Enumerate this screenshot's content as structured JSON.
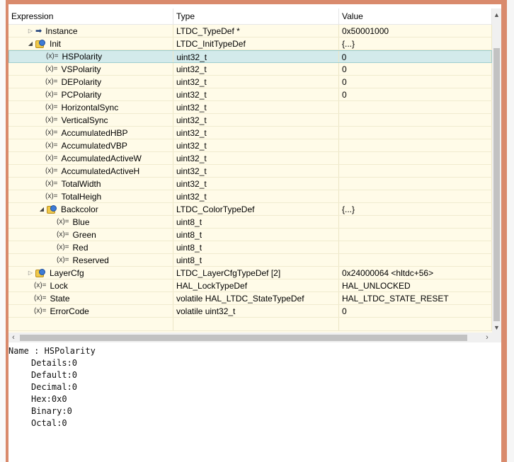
{
  "columns": {
    "expression": "Expression",
    "type": "Type",
    "value": "Value"
  },
  "rows": [
    {
      "depth": 1,
      "arrow": "collapsed",
      "icon": "pointer-icon",
      "name": "Instance",
      "type": "LTDC_TypeDef *",
      "value": "0x50001000"
    },
    {
      "depth": 1,
      "arrow": "expanded",
      "icon": "struct-icon",
      "name": "Init",
      "type": "LTDC_InitTypeDef",
      "value": "{...}"
    },
    {
      "depth": 2,
      "arrow": "none",
      "icon": "variable-icon",
      "name": "HSPolarity",
      "type": "uint32_t",
      "value": "0",
      "selected": true
    },
    {
      "depth": 2,
      "arrow": "none",
      "icon": "variable-icon",
      "name": "VSPolarity",
      "type": "uint32_t",
      "value": "0"
    },
    {
      "depth": 2,
      "arrow": "none",
      "icon": "variable-icon",
      "name": "DEPolarity",
      "type": "uint32_t",
      "value": "0"
    },
    {
      "depth": 2,
      "arrow": "none",
      "icon": "variable-icon",
      "name": "PCPolarity",
      "type": "uint32_t",
      "value": "0"
    },
    {
      "depth": 2,
      "arrow": "none",
      "icon": "variable-icon",
      "name": "HorizontalSync",
      "type": "uint32_t",
      "value": ""
    },
    {
      "depth": 2,
      "arrow": "none",
      "icon": "variable-icon",
      "name": "VerticalSync",
      "type": "uint32_t",
      "value": ""
    },
    {
      "depth": 2,
      "arrow": "none",
      "icon": "variable-icon",
      "name": "AccumulatedHBP",
      "type": "uint32_t",
      "value": ""
    },
    {
      "depth": 2,
      "arrow": "none",
      "icon": "variable-icon",
      "name": "AccumulatedVBP",
      "type": "uint32_t",
      "value": ""
    },
    {
      "depth": 2,
      "arrow": "none",
      "icon": "variable-icon",
      "name": "AccumulatedActiveW",
      "type": "uint32_t",
      "value": ""
    },
    {
      "depth": 2,
      "arrow": "none",
      "icon": "variable-icon",
      "name": "AccumulatedActiveH",
      "type": "uint32_t",
      "value": ""
    },
    {
      "depth": 2,
      "arrow": "none",
      "icon": "variable-icon",
      "name": "TotalWidth",
      "type": "uint32_t",
      "value": ""
    },
    {
      "depth": 2,
      "arrow": "none",
      "icon": "variable-icon",
      "name": "TotalHeigh",
      "type": "uint32_t",
      "value": ""
    },
    {
      "depth": 2,
      "arrow": "expanded",
      "icon": "struct-icon",
      "name": "Backcolor",
      "type": "LTDC_ColorTypeDef",
      "value": "{...}"
    },
    {
      "depth": 3,
      "arrow": "none",
      "icon": "variable-icon",
      "name": "Blue",
      "type": "uint8_t",
      "value": ""
    },
    {
      "depth": 3,
      "arrow": "none",
      "icon": "variable-icon",
      "name": "Green",
      "type": "uint8_t",
      "value": ""
    },
    {
      "depth": 3,
      "arrow": "none",
      "icon": "variable-icon",
      "name": "Red",
      "type": "uint8_t",
      "value": ""
    },
    {
      "depth": 3,
      "arrow": "none",
      "icon": "variable-icon",
      "name": "Reserved",
      "type": "uint8_t",
      "value": ""
    },
    {
      "depth": 1,
      "arrow": "collapsed",
      "icon": "struct-icon",
      "name": "LayerCfg",
      "type": "LTDC_LayerCfgTypeDef [2]",
      "value": "0x24000064 <hltdc+56>"
    },
    {
      "depth": 1,
      "arrow": "none",
      "icon": "variable-icon",
      "name": "Lock",
      "type": "HAL_LockTypeDef",
      "value": "HAL_UNLOCKED"
    },
    {
      "depth": 1,
      "arrow": "none",
      "icon": "variable-icon",
      "name": "State",
      "type": "volatile HAL_LTDC_StateTypeDef",
      "value": "HAL_LTDC_STATE_RESET"
    },
    {
      "depth": 1,
      "arrow": "none",
      "icon": "variable-icon",
      "name": "ErrorCode",
      "type": "volatile uint32_t",
      "value": "0"
    }
  ],
  "variable_glyph": "(x)=",
  "details": {
    "name_line": "Name : HSPolarity",
    "lines": [
      "Details:0",
      "Default:0",
      "Decimal:0",
      "Hex:0x0",
      "Binary:0",
      "Octal:0"
    ]
  },
  "colors": {
    "frame": "#d98a6c",
    "tree_bg": "#fffbe8",
    "selection": "#d3eaeb"
  }
}
